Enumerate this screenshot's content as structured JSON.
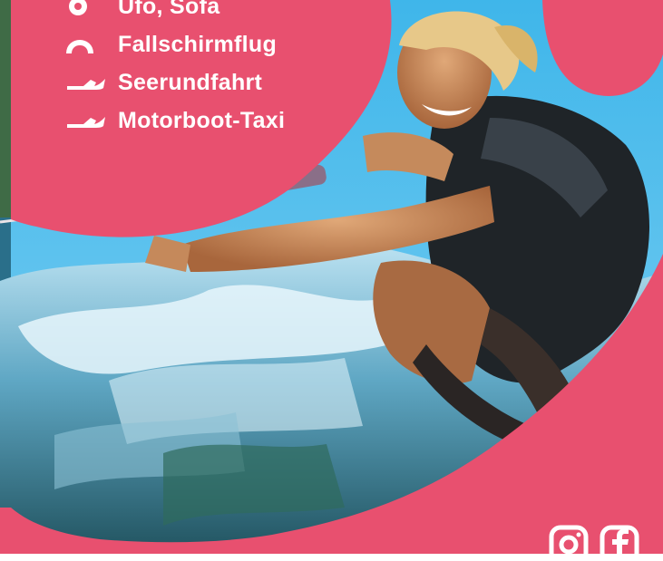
{
  "brand": {
    "pink": "#e8506f",
    "sky": "#43b9ec",
    "white": "#ffffff"
  },
  "services": [
    {
      "label": "Ufo, Sofa",
      "icon": "ufo-icon"
    },
    {
      "label": "Fallschirmflug",
      "icon": "parachute-icon"
    },
    {
      "label": "Seerundfahrt",
      "icon": "boat-icon"
    },
    {
      "label": "Motorboot-Taxi",
      "icon": "boat-icon"
    }
  ],
  "social": [
    {
      "icon": "instagram-icon"
    },
    {
      "icon": "facebook-icon"
    }
  ]
}
